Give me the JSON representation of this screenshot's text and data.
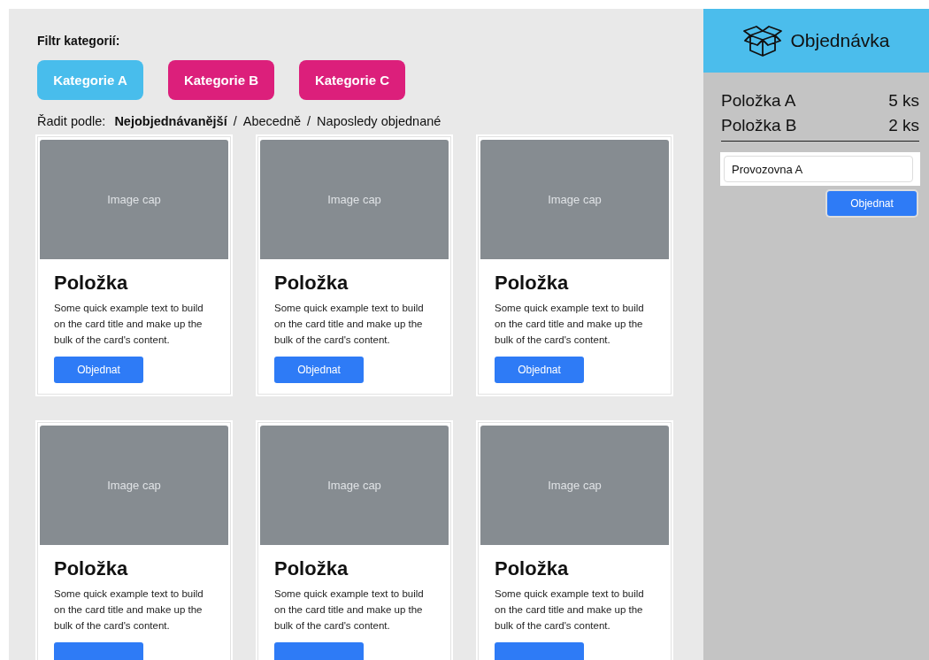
{
  "filter": {
    "label": "Filtr kategorií:",
    "categories": [
      {
        "label": "Kategorie A",
        "selected": true
      },
      {
        "label": "Kategorie B",
        "selected": false
      },
      {
        "label": "Kategorie C",
        "selected": false
      }
    ]
  },
  "sort": {
    "label": "Řadit podle:",
    "options": [
      {
        "label": "Nejobjednávanější",
        "selected": true
      },
      {
        "separator": "/",
        "label": "Abecedně",
        "selected": false
      },
      {
        "separator": "/",
        "label": "Naposledy objednané",
        "selected": false
      }
    ]
  },
  "cards": [
    {
      "image_text": "Image cap",
      "title": "Položka",
      "text": "Some quick example text to build on the card title and make up the bulk of the card's content.",
      "button": "Objednat"
    },
    {
      "image_text": "Image cap",
      "title": "Položka",
      "text": "Some quick example text to build on the card title and make up the bulk of the card's content.",
      "button": "Objednat"
    },
    {
      "image_text": "Image cap",
      "title": "Položka",
      "text": "Some quick example text to build on the card title and make up the bulk of the card's content.",
      "button": "Objednat"
    },
    {
      "image_text": "Image cap",
      "title": "Položka",
      "text": "Some quick example text to build on the card title and make up the bulk of the card's content."
    },
    {
      "image_text": "Image cap",
      "title": "Položka",
      "text": "Some quick example text to build on the card title and make up the bulk of the card's content."
    },
    {
      "image_text": "Image cap",
      "title": "Položka",
      "text": "Some quick example text to build on the card title and make up the bulk of the card's content."
    }
  ],
  "order": {
    "title": "Objednávka",
    "items": [
      {
        "name": "Položka A",
        "quantity": "5 ks"
      },
      {
        "name": "Položka B",
        "quantity": "2 ks"
      }
    ],
    "location": {
      "value": "Provozovna A"
    },
    "button": "Objednat"
  }
}
